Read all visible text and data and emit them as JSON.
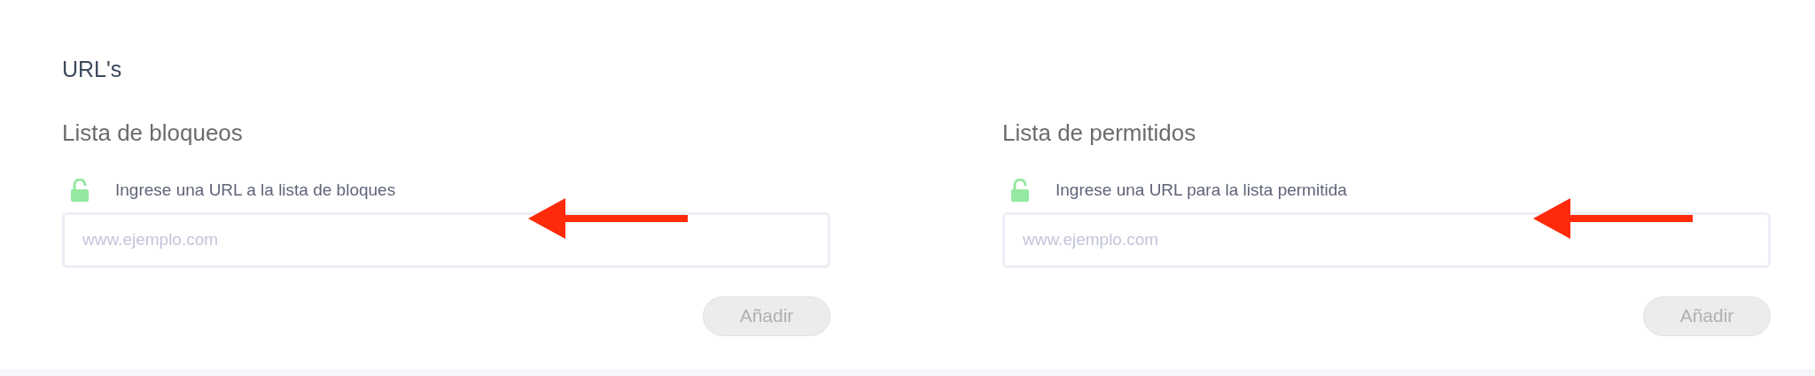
{
  "title": "URL's",
  "lists": [
    {
      "heading": "Lista de bloqueos",
      "label": "Ingrese una URL a la lista de bloques",
      "placeholder": "www.ejemplo.com",
      "button": {
        "label": "Añadir",
        "disabled": true
      }
    },
    {
      "heading": "Lista de permitidos",
      "label": "Ingrese una URL para la lista permitida",
      "placeholder": "www.ejemplo.com",
      "button": {
        "label": "Añadir",
        "disabled": true
      }
    }
  ]
}
